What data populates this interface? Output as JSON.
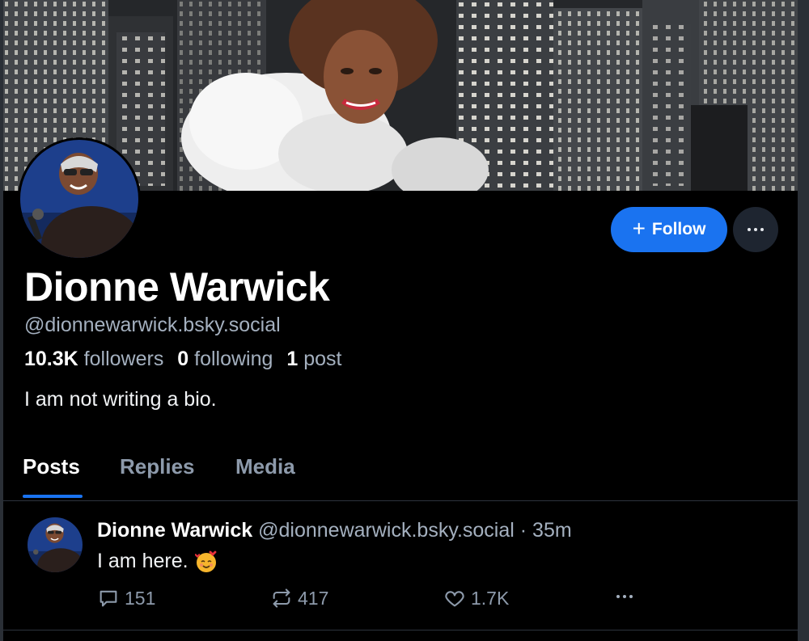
{
  "profile": {
    "display_name": "Dionne Warwick",
    "handle": "@dionnewarwick.bsky.social",
    "followers_count": "10.3K",
    "followers_label": "followers",
    "following_count": "0",
    "following_label": "following",
    "posts_count": "1",
    "posts_label": "post",
    "bio": "I am not writing a bio."
  },
  "actions": {
    "follow_icon": "plus-icon",
    "follow_label": "Follow",
    "more_icon": "ellipsis-icon"
  },
  "tabs": [
    {
      "label": "Posts",
      "active": true
    },
    {
      "label": "Replies",
      "active": false
    },
    {
      "label": "Media",
      "active": false
    }
  ],
  "post": {
    "author_name": "Dionne Warwick",
    "author_handle": "@dionnewarwick.bsky.social",
    "time": "· 35m",
    "text": "I am here.",
    "emoji": "smiling-face-with-hearts-emoji",
    "reply_count": "151",
    "repost_count": "417",
    "like_count": "1.7K"
  },
  "colors": {
    "background": "#000000",
    "accent": "#1a73f0",
    "muted_text": "#a4b0bf",
    "divider": "#2c333d"
  }
}
